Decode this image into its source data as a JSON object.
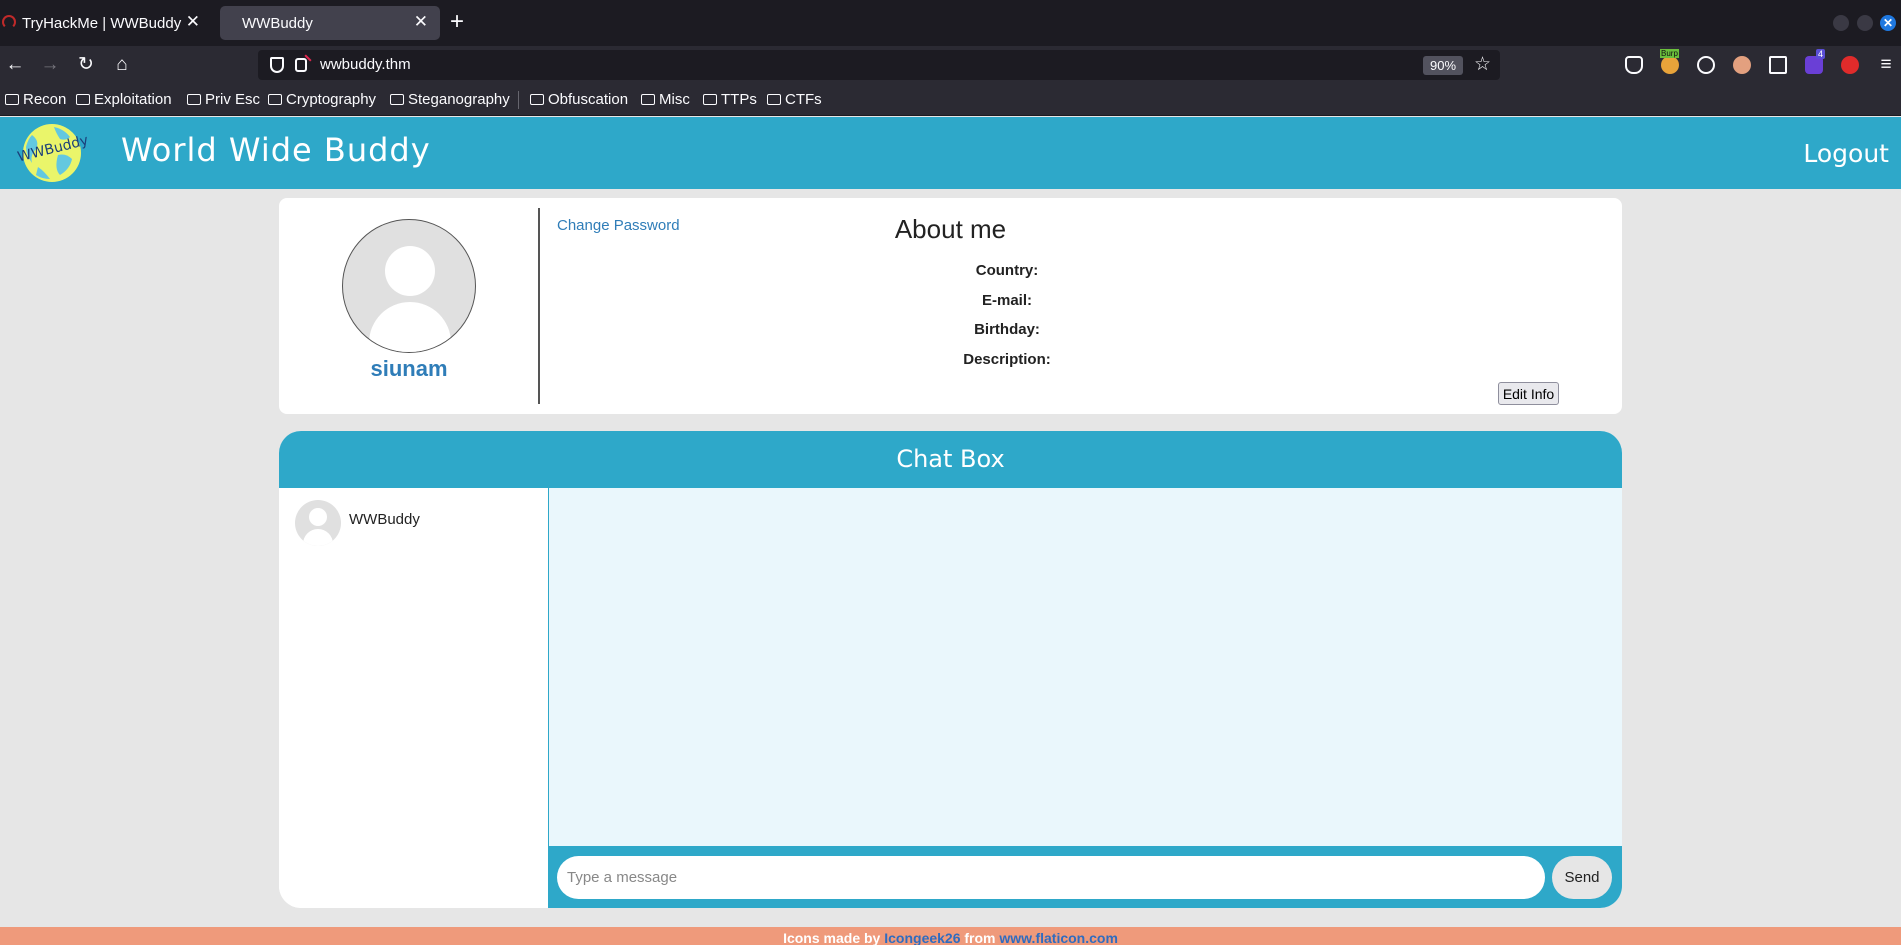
{
  "browser": {
    "tabs": [
      {
        "title": "TryHackMe | WWBuddy"
      },
      {
        "title": "WWBuddy"
      }
    ],
    "url": "wwbuddy.thm",
    "zoom": "90%",
    "bookmarks": [
      "Recon",
      "Exploitation",
      "Priv Esc",
      "Cryptography",
      "Steganography",
      "Obfuscation",
      "Misc",
      "TTPs",
      "CTFs"
    ],
    "extensions": {
      "burp_label": "Burp",
      "badge_count": "4"
    }
  },
  "header": {
    "title": "World Wide Buddy",
    "logo_text": "WWBuddy",
    "logout": "Logout"
  },
  "profile": {
    "username": "siunam",
    "change_password": "Change Password",
    "about_title": "About me",
    "fields": [
      "Country:",
      "E-mail:",
      "Birthday:",
      "Description:"
    ],
    "edit_button": "Edit Info"
  },
  "chat": {
    "title": "Chat Box",
    "contacts": [
      {
        "name": "WWBuddy"
      }
    ],
    "input_placeholder": "Type a message",
    "send": "Send"
  },
  "footer": {
    "prefix": "Icons made by",
    "author": "Icongeek26",
    "middle": "from",
    "site": "www.flaticon.com"
  },
  "colors": {
    "accent": "#2ea8c9",
    "footer": "#ef9a7b",
    "link": "#2f7db8",
    "page_bg": "#e6e6e6",
    "chat_bg": "#eaf7fc"
  }
}
